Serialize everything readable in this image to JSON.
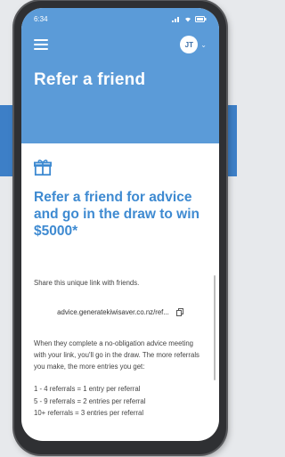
{
  "status_bar": {
    "time": "6:34"
  },
  "header": {
    "avatar_initials": "JT",
    "title": "Refer a friend"
  },
  "main": {
    "headline": "Refer a friend for advice and go in the draw to win $5000*",
    "share_text": "Share this unique link with friends.",
    "referral_link": "advice.generatekiwisaver.co.nz/ref...",
    "description": "When they complete a no-obligation advice meeting with your link, you'll go in the draw. The more referrals you make, the more entries you get:",
    "tiers": [
      "1 - 4 referrals = 1 entry per referral",
      "5 - 9 referrals = 2 entries per referral",
      "10+ referrals = 3 entries per referral"
    ]
  },
  "colors": {
    "header_bg": "#5b9bd8",
    "accent": "#3e8ad1"
  },
  "icons": {
    "menu": "hamburger-menu-icon",
    "gift": "gift-icon",
    "copy": "copy-icon"
  }
}
